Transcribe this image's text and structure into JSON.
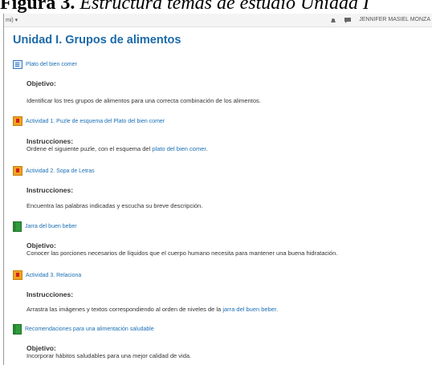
{
  "caption": {
    "bold": "Figura 3.",
    "rest": "Estructura temas de estudio Unidad I"
  },
  "navbar": {
    "left": "mi) ▾",
    "user": "JENNIFER MASIEL MONZA"
  },
  "title": "Unidad I. Grupos de alimentos",
  "items": [
    {
      "label": "Plato del bien comer",
      "icon": "plato-icon"
    },
    {
      "label": "Actividad 1. Puzle de esquema del Plato del bien comer",
      "icon": "activity-icon"
    },
    {
      "label": "Actividad 2. Sopa de Letras",
      "icon": "activity-icon"
    },
    {
      "label": "Jarra del buen beber",
      "icon": "book-icon"
    },
    {
      "label": "Actividad 3. Relaciona",
      "icon": "activity-icon"
    },
    {
      "label": "Recomendaciones para una alimentación saludable",
      "icon": "book-icon"
    }
  ],
  "sections": {
    "objetivo_label": "Objetivo:",
    "instrucciones_label": "Instrucciones:",
    "s1_text": "Identificar los tres grupos de alimentos para una correcta combinación de los alimentos.",
    "s2_text_a": "Ordene el siguiente puzle, con el esquema del ",
    "s2_link": "plato del bien comer",
    "s2_text_b": ".",
    "s3_text": "Encuentra las palabras indicadas y escucha su breve descripción.",
    "s4_text": "Conocer las porciones necesarios de líquidos que el cuerpo humano necesita para mantener una buena hidratación.",
    "s5_text_a": "Arrastra las imágenes y textos correspondiendo al orden de niveles de la ",
    "s5_link": "jarra del buen beber",
    "s5_text_b": ".",
    "s6_text": "Incorporar hábitos saludables para una mejor calidad de vida."
  }
}
